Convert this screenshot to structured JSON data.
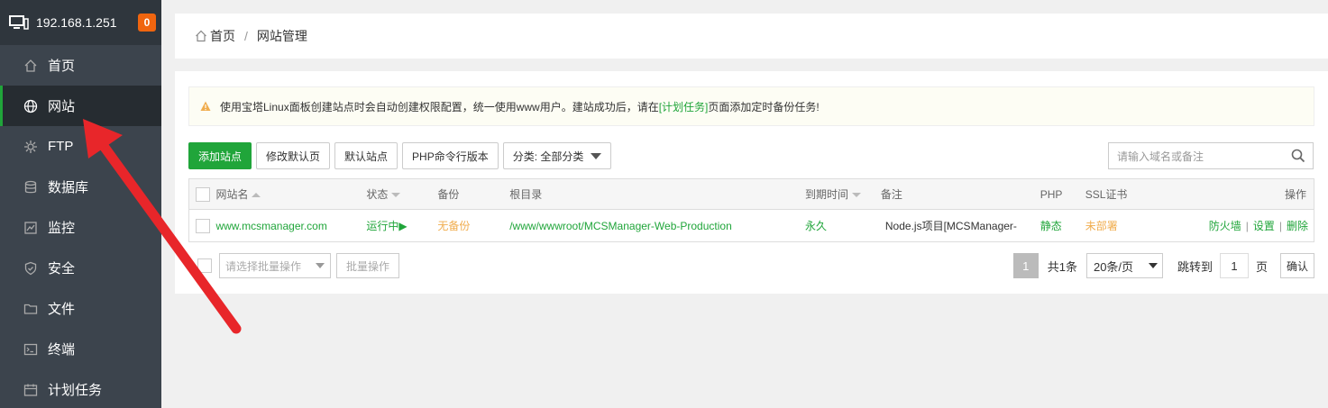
{
  "sidebar": {
    "host": "192.168.1.251",
    "badge": "0",
    "items": [
      {
        "label": "首页",
        "icon": "home-icon"
      },
      {
        "label": "网站",
        "icon": "globe-icon",
        "active": true
      },
      {
        "label": "FTP",
        "icon": "ftp-icon"
      },
      {
        "label": "数据库",
        "icon": "database-icon"
      },
      {
        "label": "监控",
        "icon": "monitor-icon"
      },
      {
        "label": "安全",
        "icon": "shield-icon"
      },
      {
        "label": "文件",
        "icon": "folder-icon"
      },
      {
        "label": "终端",
        "icon": "terminal-icon"
      },
      {
        "label": "计划任务",
        "icon": "calendar-icon"
      }
    ]
  },
  "breadcrumb": {
    "home": "首页",
    "separator": "/",
    "current": "网站管理"
  },
  "notice": {
    "before": "使用宝塔Linux面板创建站点时会自动创建权限配置，统一使用www用户。建站成功后，请在",
    "link": "[计划任务]",
    "after": "页面添加定时备份任务!"
  },
  "toolbar": {
    "add_site": "添加站点",
    "edit_default_page": "修改默认页",
    "default_site": "默认站点",
    "php_cli_version": "PHP命令行版本",
    "category": "分类: 全部分类"
  },
  "search": {
    "placeholder": "请输入域名或备注"
  },
  "table": {
    "headers": {
      "name": "网站名",
      "status": "状态",
      "backup": "备份",
      "root": "根目录",
      "expire": "到期时间",
      "note": "备注",
      "php": "PHP",
      "ssl": "SSL证书",
      "ops": "操作"
    },
    "rows": [
      {
        "name": "www.mcsmanager.com",
        "status": "运行中▶",
        "backup": "无备份",
        "root": "/www/wwwroot/MCSManager-Web-Production",
        "expire": "永久",
        "note": "Node.js项目[MCSManager-",
        "php": "静态",
        "ssl": "未部署",
        "op_firewall": "防火墙",
        "op_settings": "设置",
        "op_delete": "删除"
      }
    ]
  },
  "footer": {
    "batch_placeholder": "请选择批量操作",
    "batch_button": "批量操作",
    "current_page": "1",
    "total": "共1条",
    "page_size": "20条/页",
    "jump_label": "跳转到",
    "jump_value": "1",
    "page_unit": "页",
    "confirm": "确认"
  },
  "colors": {
    "accent": "#20a53a",
    "sidebar": "#3c444d",
    "badge": "#f0650f",
    "warning": "#f0ad4e",
    "annotation_arrow": "#e8262a"
  }
}
